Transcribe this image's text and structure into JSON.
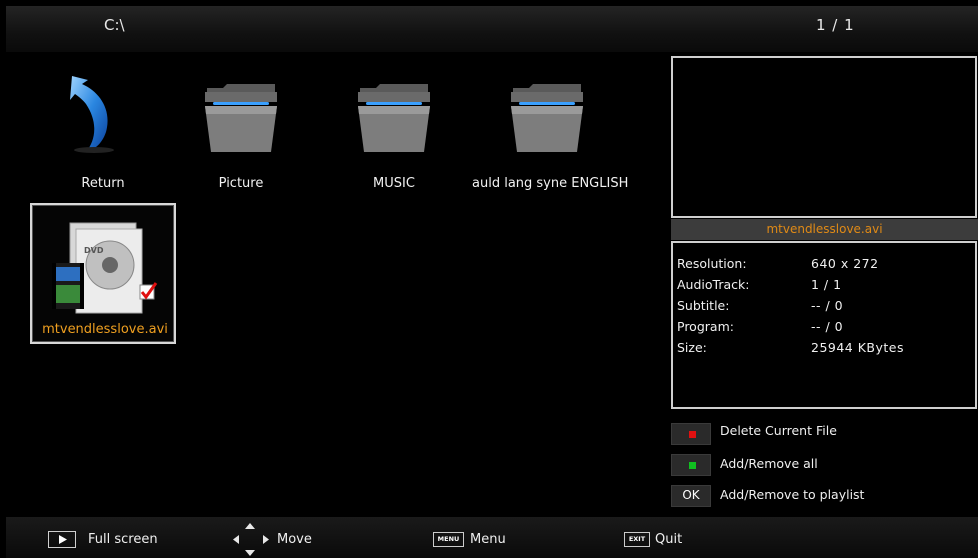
{
  "header": {
    "path": "C:\\",
    "page": "1 / 1"
  },
  "grid": {
    "items": [
      {
        "label": "Return",
        "icon": "return-arrow-icon"
      },
      {
        "label": "Picture",
        "icon": "folder-icon"
      },
      {
        "label": "MUSIC",
        "icon": "folder-icon"
      },
      {
        "label": "auld lang syne ENGLISH",
        "icon": "folder-icon"
      },
      {
        "label": "mtvendlesslove.avi",
        "icon": "video-file-icon",
        "selected": true,
        "checked": true
      }
    ]
  },
  "info": {
    "filename": "mtvendlesslove.avi",
    "rows": [
      {
        "label": "Resolution:",
        "value": "640 x 272"
      },
      {
        "label": "AudioTrack:",
        "value": "1 / 1"
      },
      {
        "label": "Subtitle:",
        "value": "-- / 0"
      },
      {
        "label": "Program:",
        "value": "-- / 0"
      },
      {
        "label": "Size:",
        "value": "25944 KBytes"
      }
    ]
  },
  "actions": [
    {
      "key": "red",
      "color": "#e01010",
      "label": "Delete Current File"
    },
    {
      "key": "green",
      "color": "#10c020",
      "label": "Add/Remove all"
    },
    {
      "key": "OK",
      "label": "Add/Remove to playlist"
    }
  ],
  "footer": {
    "fullscreen": "Full screen",
    "move": "Move",
    "menu_key": "MENU",
    "menu": "Menu",
    "exit_key": "EXIT",
    "quit": "Quit"
  },
  "colors": {
    "accent": "#f0a020",
    "background": "#000000"
  }
}
